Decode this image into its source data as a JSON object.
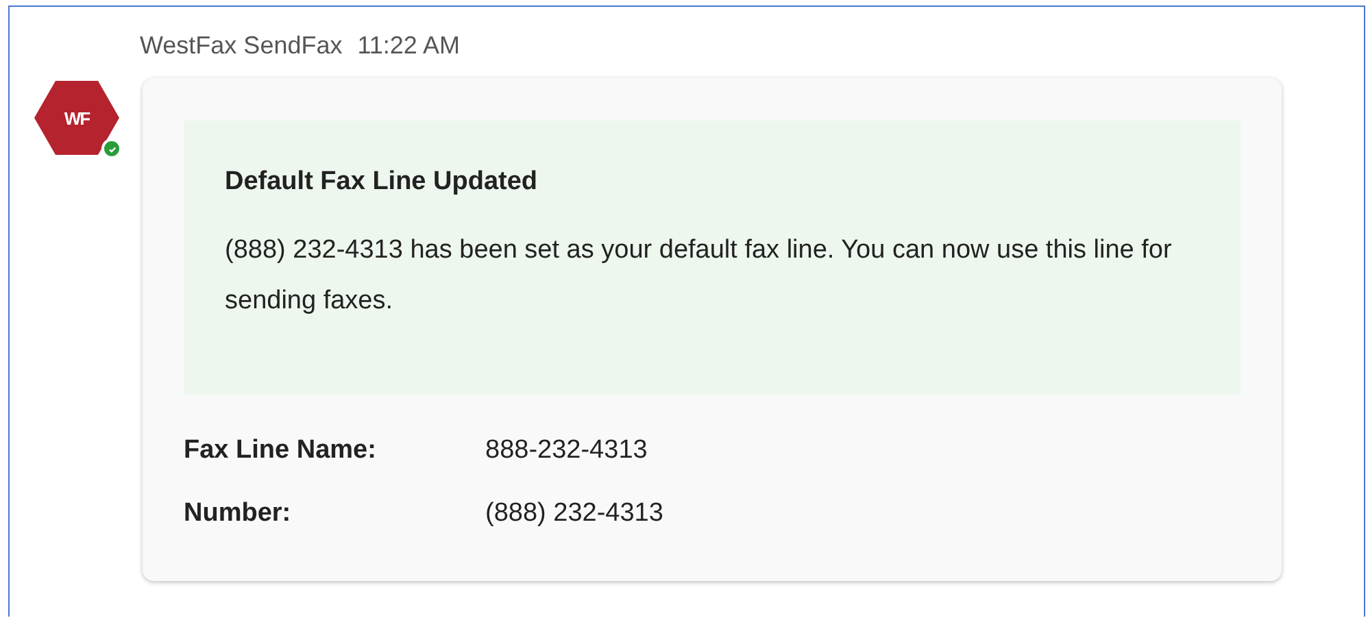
{
  "message": {
    "sender": "WestFax SendFax",
    "time": "11:22 AM",
    "avatar": {
      "initials": "WF",
      "online": true
    },
    "notice": {
      "title": "Default Fax Line Updated",
      "body": "(888) 232-4313 has been set as your default fax line. You can now use this line for sending faxes."
    },
    "fields": [
      {
        "label": "Fax Line Name:",
        "value": "888-232-4313"
      },
      {
        "label": "Number:",
        "value": "(888) 232-4313"
      }
    ]
  }
}
